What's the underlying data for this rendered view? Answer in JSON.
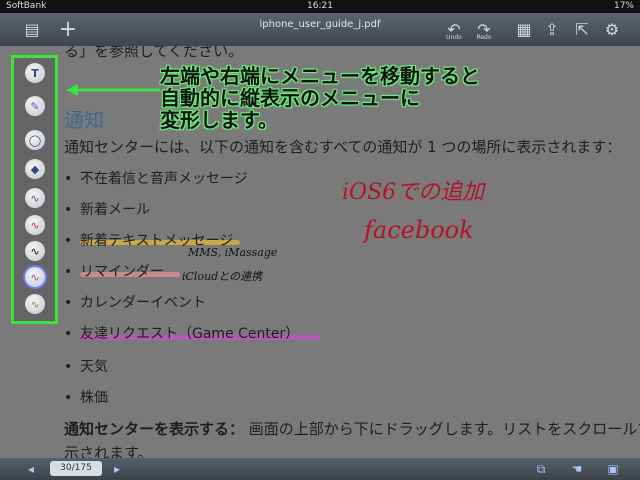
{
  "status": {
    "carrier": "SoftBank",
    "time": "16:21",
    "battery": "17%"
  },
  "toolbar": {
    "title": "iphone_user_guide_j.pdf",
    "undo": "Undo",
    "redo": "Redo"
  },
  "doc": {
    "top_line": "る」を参照してください。",
    "heading": "通知",
    "intro": "通知センターには、以下の通知を含むすべての通知が 1 つの場所に表示されます：",
    "bullets": [
      "不在着信と音声メッセージ",
      "新着メール",
      "新着テキストメッセージ",
      "リマインダー",
      "カレンダーイベント",
      "友達リクエスト（Game Center）",
      "天気",
      "株価"
    ],
    "bottom_bold": "通知センターを表示する：",
    "bottom_rest": "画面の上部から下にドラッグします。リストをスクロールす",
    "bottom_line2": "示されます。"
  },
  "annotation": {
    "callout": [
      "左端や右端にメニューを移動すると",
      "自動的に縦表示のメニューに",
      "変形します。"
    ],
    "hand_ios6": "iOS6での追加",
    "hand_facebook": "facebook",
    "hand_mms": "MMS, iMassage",
    "hand_icloud": "iCloudとの連携"
  },
  "bottombar": {
    "page": "30/175"
  },
  "colors": {
    "highlight_yellow": "#c9a84a",
    "highlight_pink": "#c98a8a",
    "highlight_purple": "#b35ab3",
    "hand_red": "#b3122a",
    "menu_border": "#3ee23e"
  }
}
